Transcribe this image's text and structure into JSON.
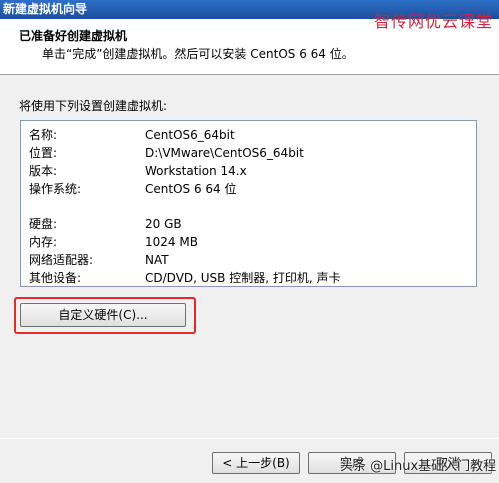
{
  "window": {
    "title": "新建虚拟机向导"
  },
  "watermark": {
    "top": "智传网优云课堂",
    "bottom": "头条 @Linux基础入门教程"
  },
  "header": {
    "title": "已准备好创建虚拟机",
    "subtitle": "单击“完成”创建虚拟机。然后可以安装 CentOS 6 64 位。"
  },
  "intro": "将使用下列设置创建虚拟机:",
  "summary": [
    {
      "key": "名称:",
      "value": "CentOS6_64bit"
    },
    {
      "key": "位置:",
      "value": "D:\\VMware\\CentOS6_64bit"
    },
    {
      "key": "版本:",
      "value": "Workstation 14.x"
    },
    {
      "key": "操作系统:",
      "value": "CentOS 6 64 位"
    },
    {
      "key": "硬盘:",
      "value": "20 GB"
    },
    {
      "key": "内存:",
      "value": "1024 MB"
    },
    {
      "key": "网络适配器:",
      "value": "NAT"
    },
    {
      "key": "其他设备:",
      "value": "CD/DVD, USB 控制器, 打印机, 声卡"
    }
  ],
  "buttons": {
    "customize": "自定义硬件(C)...",
    "back": "< 上一步(B)",
    "finish": "完成",
    "cancel": "取消"
  }
}
